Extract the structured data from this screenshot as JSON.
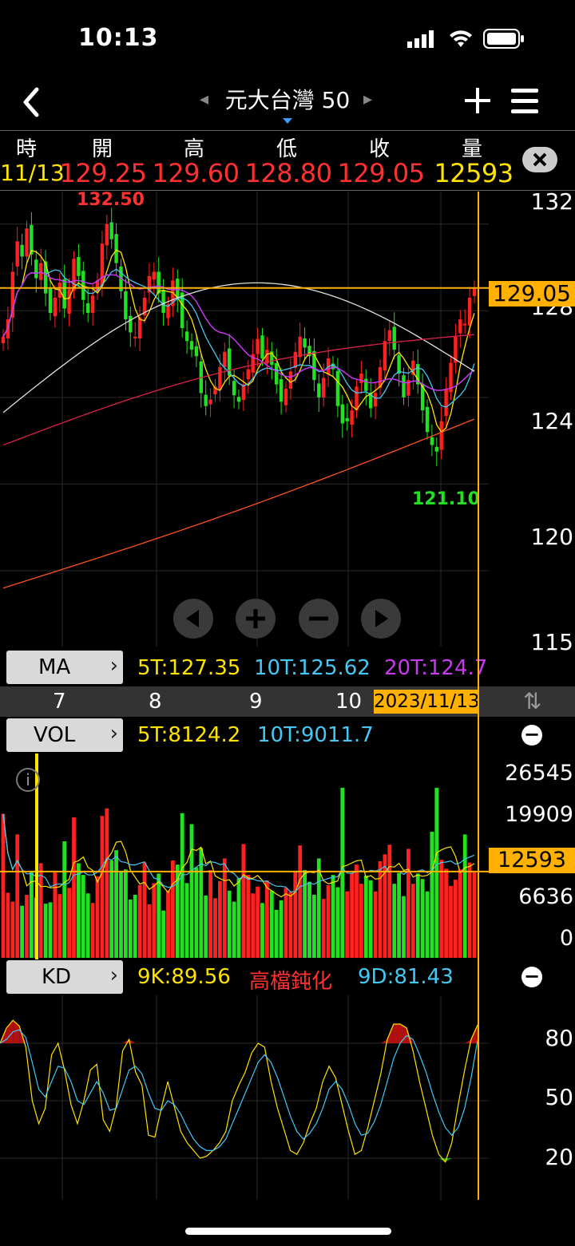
{
  "status": {
    "time": "10:13"
  },
  "nav": {
    "title": "元大台灣 50",
    "prev": "◂",
    "next": "▸"
  },
  "quote": {
    "headers": [
      "時",
      "開",
      "高",
      "低",
      "收",
      "量"
    ],
    "date": "11/13",
    "open": "129.25",
    "high": "129.60",
    "low": "128.80",
    "close": "129.05",
    "volume": "12593"
  },
  "price_panel": {
    "y_labels": [
      "132",
      "128",
      "124",
      "120",
      "115"
    ],
    "current": "129.05",
    "max_label": "132.50",
    "min_label": "121.10",
    "y_range": [
      112.5,
      133.5
    ]
  },
  "ma_bar": {
    "label": "MA",
    "items": [
      {
        "text": "5T:127.35",
        "color": "#ffe300"
      },
      {
        "text": "10T:125.62",
        "color": "#44c8f5"
      },
      {
        "text": "20T:124.7",
        "color": "#c838f0"
      }
    ]
  },
  "x_axis": {
    "labels": [
      "7",
      "8",
      "9",
      "10"
    ],
    "current_date": "2023/11/13"
  },
  "vol_panel": {
    "label": "VOL",
    "items": [
      {
        "text": "5T:8124.2",
        "color": "#ffe300"
      },
      {
        "text": "10T:9011.7",
        "color": "#44c8f5"
      }
    ],
    "y_labels": [
      "26545",
      "19909",
      "6636",
      "0"
    ],
    "current": "12593",
    "info": "i"
  },
  "kd_panel": {
    "label": "KD",
    "k_text": "9K:89.56",
    "status_text": "高檔鈍化",
    "d_text": "9D:81.43",
    "y_labels": [
      "80",
      "50",
      "20"
    ]
  },
  "icons": {
    "back": "‹",
    "add": "+",
    "menu": "≡",
    "close": "×",
    "left": "◀",
    "zoom_in": "+",
    "zoom_out": "−",
    "right": "▶",
    "minus": "−",
    "chevron": "›",
    "sort": "⇅"
  },
  "colors": {
    "up": "#ff2020",
    "down": "#22e022",
    "ma5": "#ffe300",
    "ma10": "#44c8f5",
    "ma20": "#c838f0",
    "ma60": "#e0e0e0",
    "ma120": "#e0204a",
    "ma240": "#ff5020",
    "crosshair": "#ffb000"
  },
  "chart_data": {
    "type": "candlestick",
    "close": [
      126.8,
      127.6,
      129.8,
      131.2,
      130.5,
      131.8,
      130.6,
      129.5,
      130.2,
      128.8,
      127.9,
      128.6,
      129.3,
      128.1,
      129.0,
      130.4,
      129.6,
      128.5,
      127.9,
      128.7,
      129.4,
      131.1,
      132.0,
      131.3,
      130.2,
      128.9,
      127.6,
      127.0,
      126.8,
      127.7,
      128.6,
      129.6,
      129.8,
      128.8,
      127.9,
      128.3,
      129.4,
      128.6,
      127.2,
      126.6,
      126.2,
      125.9,
      124.2,
      123.6,
      123.9,
      124.5,
      125.4,
      126.1,
      125.0,
      124.1,
      123.8,
      124.6,
      125.3,
      126.0,
      126.7,
      125.8,
      126.2,
      125.5,
      124.6,
      123.8,
      124.4,
      125.2,
      126.1,
      126.8,
      126.3,
      125.9,
      124.8,
      124.0,
      124.9,
      125.8,
      125.3,
      123.6,
      122.8,
      122.9,
      123.4,
      124.5,
      125.1,
      124.3,
      123.5,
      124.2,
      125.4,
      126.6,
      127.1,
      126.2,
      125.1,
      124.0,
      124.8,
      125.7,
      124.6,
      123.4,
      122.4,
      121.8,
      121.5,
      122.9,
      124.4,
      125.6,
      126.8,
      127.6,
      127.4,
      128.6,
      129.05
    ],
    "volume": [
      21000,
      9500,
      8200,
      18000,
      7600,
      9200,
      12500,
      8800,
      13800,
      7900,
      8100,
      12700,
      9300,
      17000,
      10200,
      20500,
      13800,
      12100,
      9400,
      8000,
      11900,
      20700,
      21800,
      14200,
      15700,
      12600,
      12900,
      8500,
      9200,
      10600,
      13900,
      7800,
      10900,
      12300,
      6900,
      9800,
      14200,
      13600,
      21100,
      10900,
      19500,
      13200,
      16000,
      9100,
      12800,
      8700,
      11200,
      14500,
      9800,
      8200,
      11600,
      16600,
      12100,
      9400,
      10400,
      8000,
      11300,
      9800,
      7000,
      8400,
      10200,
      9600,
      12700,
      16400,
      12800,
      11100,
      9200,
      14500,
      8600,
      10600,
      12100,
      10300,
      24800,
      9700,
      12400,
      13600,
      10800,
      12000,
      11300,
      9700,
      14100,
      15100,
      16500,
      10800,
      12400,
      9000,
      15900,
      10800,
      12300,
      11500,
      9700,
      18400,
      24800,
      14300,
      13000,
      10500,
      11400,
      12900,
      18000,
      13900,
      12593
    ],
    "k": [
      80,
      88,
      92,
      89,
      78,
      50,
      38,
      46,
      74,
      80,
      66,
      48,
      38,
      50,
      66,
      69,
      40,
      34,
      47,
      76,
      82,
      65,
      58,
      32,
      31,
      46,
      60,
      47,
      34,
      28,
      24,
      20,
      21,
      24,
      28,
      34,
      50,
      58,
      65,
      75,
      80,
      78,
      60,
      46,
      35,
      24,
      22,
      28,
      38,
      46,
      60,
      68,
      62,
      48,
      34,
      22,
      24,
      36,
      50,
      64,
      82,
      90,
      90,
      88,
      76,
      60,
      46,
      32,
      22,
      18,
      28,
      48,
      66,
      82,
      89.56
    ],
    "d": [
      80,
      82,
      86,
      87,
      83,
      70,
      56,
      52,
      60,
      68,
      67,
      60,
      50,
      48,
      54,
      60,
      54,
      45,
      46,
      56,
      66,
      68,
      64,
      54,
      46,
      45,
      50,
      48,
      43,
      36,
      30,
      26,
      24,
      24,
      26,
      30,
      38,
      46,
      54,
      62,
      70,
      74,
      70,
      62,
      52,
      42,
      34,
      30,
      33,
      38,
      46,
      56,
      60,
      56,
      48,
      38,
      32,
      33,
      39,
      48,
      60,
      72,
      80,
      84,
      82,
      74,
      65,
      54,
      44,
      36,
      32,
      36,
      46,
      62,
      81.43
    ]
  }
}
